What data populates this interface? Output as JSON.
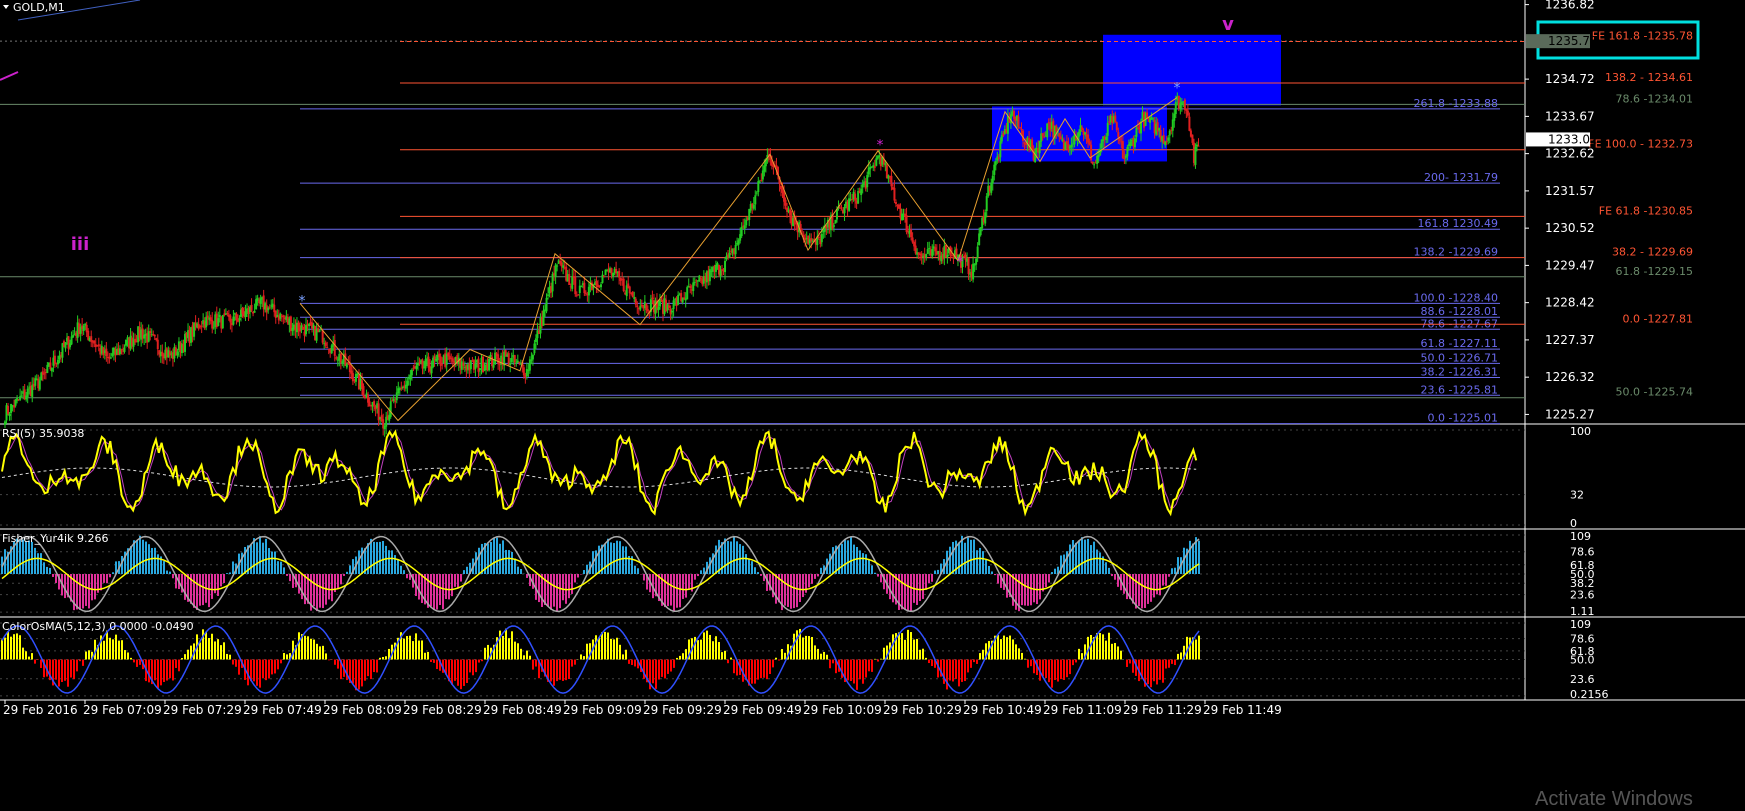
{
  "window": {
    "title": "GOLD,M1",
    "menu_icon": "triangle-down-icon"
  },
  "colors": {
    "background": "#000000",
    "bull": "#22cc22",
    "bear": "#e02020",
    "fib_blue": "#6a6aee",
    "fib_red": "#ff5533",
    "fib_gray": "#6a8a6a",
    "zigzag": "#e8a030",
    "rsi_main": "#ffff00",
    "rsi_signal": "#c040c0",
    "hist_pos": "#29a8e0",
    "hist_neg": "#e0309a",
    "signal": "#ffff00",
    "cosma_pos": "#ffff00",
    "cosma_neg": "#ff0000",
    "cosma_line": "#3050ff",
    "zone": "#0000ff",
    "highlight": "#00e0e0",
    "wave_label": "#cc22cc"
  },
  "chart_data": [
    {
      "type": "candlestick",
      "title": "GOLD,M1",
      "price_axis": {
        "ticks": [
          "1236.82",
          "1234.72",
          "1233.67",
          "1232.62",
          "1231.57",
          "1230.52",
          "1229.47",
          "1228.42",
          "1227.37",
          "1226.32",
          "1225.27"
        ],
        "tick_values": [
          1236.82,
          1234.72,
          1233.67,
          1232.62,
          1231.57,
          1230.52,
          1229.47,
          1228.42,
          1227.37,
          1226.32,
          1225.27
        ],
        "range": [
          1225.0,
          1236.95
        ],
        "current_price": "1233.02",
        "marked_price": "1235.79"
      },
      "time_axis": {
        "ticks": [
          "29 Feb 2016",
          "29 Feb 07:09",
          "29 Feb 07:29",
          "29 Feb 07:49",
          "29 Feb 08:09",
          "29 Feb 08:29",
          "29 Feb 08:49",
          "29 Feb 09:09",
          "29 Feb 09:29",
          "29 Feb 09:49",
          "29 Feb 10:09",
          "29 Feb 10:29",
          "29 Feb 10:49",
          "29 Feb 11:09",
          "29 Feb 11:29",
          "29 Feb 11:49"
        ]
      },
      "close_path": [
        [
          0,
          1225.3
        ],
        [
          25,
          1226.3
        ],
        [
          50,
          1227.8
        ],
        [
          68,
          1226.8
        ],
        [
          90,
          1227.6
        ],
        [
          110,
          1226.9
        ],
        [
          130,
          1227.9
        ],
        [
          150,
          1227.9
        ],
        [
          170,
          1228.4
        ],
        [
          190,
          1227.8
        ],
        [
          210,
          1227.5
        ],
        [
          230,
          1226.4
        ],
        [
          250,
          1225.1
        ],
        [
          270,
          1226.5
        ],
        [
          290,
          1226.8
        ],
        [
          310,
          1226.6
        ],
        [
          330,
          1226.9
        ],
        [
          345,
          1226.5
        ],
        [
          352,
          1227.5
        ],
        [
          365,
          1229.5
        ],
        [
          380,
          1228.7
        ],
        [
          400,
          1229.3
        ],
        [
          420,
          1228.4
        ],
        [
          440,
          1228.3
        ],
        [
          460,
          1229.0
        ],
        [
          480,
          1229.7
        ],
        [
          497,
          1231.5
        ],
        [
          505,
          1232.7
        ],
        [
          520,
          1230.8
        ],
        [
          535,
          1230.0
        ],
        [
          550,
          1230.9
        ],
        [
          565,
          1231.5
        ],
        [
          578,
          1232.6
        ],
        [
          590,
          1231.2
        ],
        [
          605,
          1229.7
        ],
        [
          625,
          1229.9
        ],
        [
          640,
          1229.3
        ],
        [
          650,
          1231.6
        ],
        [
          665,
          1233.8
        ],
        [
          680,
          1232.6
        ],
        [
          690,
          1233.5
        ],
        [
          700,
          1232.8
        ],
        [
          712,
          1233.4
        ],
        [
          720,
          1232.3
        ],
        [
          732,
          1233.6
        ],
        [
          740,
          1232.5
        ],
        [
          752,
          1233.6
        ],
        [
          760,
          1233.4
        ],
        [
          768,
          1233.0
        ],
        [
          775,
          1234.1
        ],
        [
          781,
          1234.0
        ],
        [
          784,
          1233.2
        ],
        [
          786,
          1232.5
        ],
        [
          790,
          1232.9
        ]
      ],
      "fibonacci_levels": [
        {
          "label": "FE 161.8 -1235.78",
          "price": 1235.78,
          "style": "red-dashed"
        },
        {
          "label": "138.2 - 1234.61",
          "price": 1234.61,
          "style": "red"
        },
        {
          "label": "78.6 -1234.01",
          "price": 1234.01,
          "style": "gray"
        },
        {
          "label": "261.8 -1233.88",
          "price": 1233.88,
          "style": "blue"
        },
        {
          "label": "FE 100.0 - 1232.73",
          "price": 1232.73,
          "style": "red"
        },
        {
          "label": "200- 1231.79",
          "price": 1231.79,
          "style": "blue"
        },
        {
          "label": "FE 61.8 -1230.85",
          "price": 1230.85,
          "style": "red"
        },
        {
          "label": "161.8 1230.49",
          "price": 1230.49,
          "style": "blue"
        },
        {
          "label": "138.2 -1229.69",
          "price": 1229.69,
          "style": "blue"
        },
        {
          "label": "38.2 - 1229.69",
          "price": 1229.69,
          "style": "red"
        },
        {
          "label": "61.8 -1229.15",
          "price": 1229.15,
          "style": "gray"
        },
        {
          "label": "100.0 -1228.40",
          "price": 1228.4,
          "style": "blue"
        },
        {
          "label": "88.6 -1228.01",
          "price": 1228.01,
          "style": "blue"
        },
        {
          "label": "78.6 -1227.67",
          "price": 1227.67,
          "style": "blue"
        },
        {
          "label": "0.0 -1227.81",
          "price": 1227.81,
          "style": "red"
        },
        {
          "label": "61.8 -1227.11",
          "price": 1227.11,
          "style": "blue"
        },
        {
          "label": "50.0 -1226.71",
          "price": 1226.71,
          "style": "blue"
        },
        {
          "label": "38.2 -1226.31",
          "price": 1226.31,
          "style": "blue"
        },
        {
          "label": "23.6 -1225.81",
          "price": 1225.81,
          "style": "blue"
        },
        {
          "label": "50.0 -1225.74",
          "price": 1225.74,
          "style": "gray"
        },
        {
          "label": "0.0 -1225.01",
          "price": 1225.01,
          "style": "blue"
        }
      ],
      "wave_labels": [
        {
          "text": "iii",
          "price": 1229.9
        },
        {
          "text": "v",
          "price": 1236.1
        }
      ]
    },
    {
      "type": "line",
      "title": "RSI(5) 35.9038",
      "y_ticks": [
        "100",
        "32",
        "0"
      ],
      "tick_values": [
        100,
        32,
        0
      ],
      "range": [
        0,
        100
      ],
      "current_value": 35.9038
    },
    {
      "type": "histogram",
      "title": "Fisher_Yur4ik 9.266",
      "y_ticks": [
        "109",
        "78.6",
        "61.8",
        "50.0",
        "38.2",
        "23.6",
        "1.11"
      ],
      "tick_values": [
        100,
        78.6,
        61.8,
        50.0,
        38.2,
        23.6,
        1.11
      ],
      "range": [
        0,
        100
      ],
      "current_value": 9.266
    },
    {
      "type": "histogram",
      "title": "ColorOsMA(5,12,3) 0.0000 -0.0490",
      "y_ticks": [
        "109",
        "78.6",
        "61.8",
        "50.0",
        "23.6",
        "0.2156"
      ],
      "tick_values": [
        100,
        78.6,
        61.8,
        50.0,
        23.6,
        0.2156
      ],
      "range": [
        0,
        100
      ]
    }
  ],
  "watermark": "Activate Windows"
}
